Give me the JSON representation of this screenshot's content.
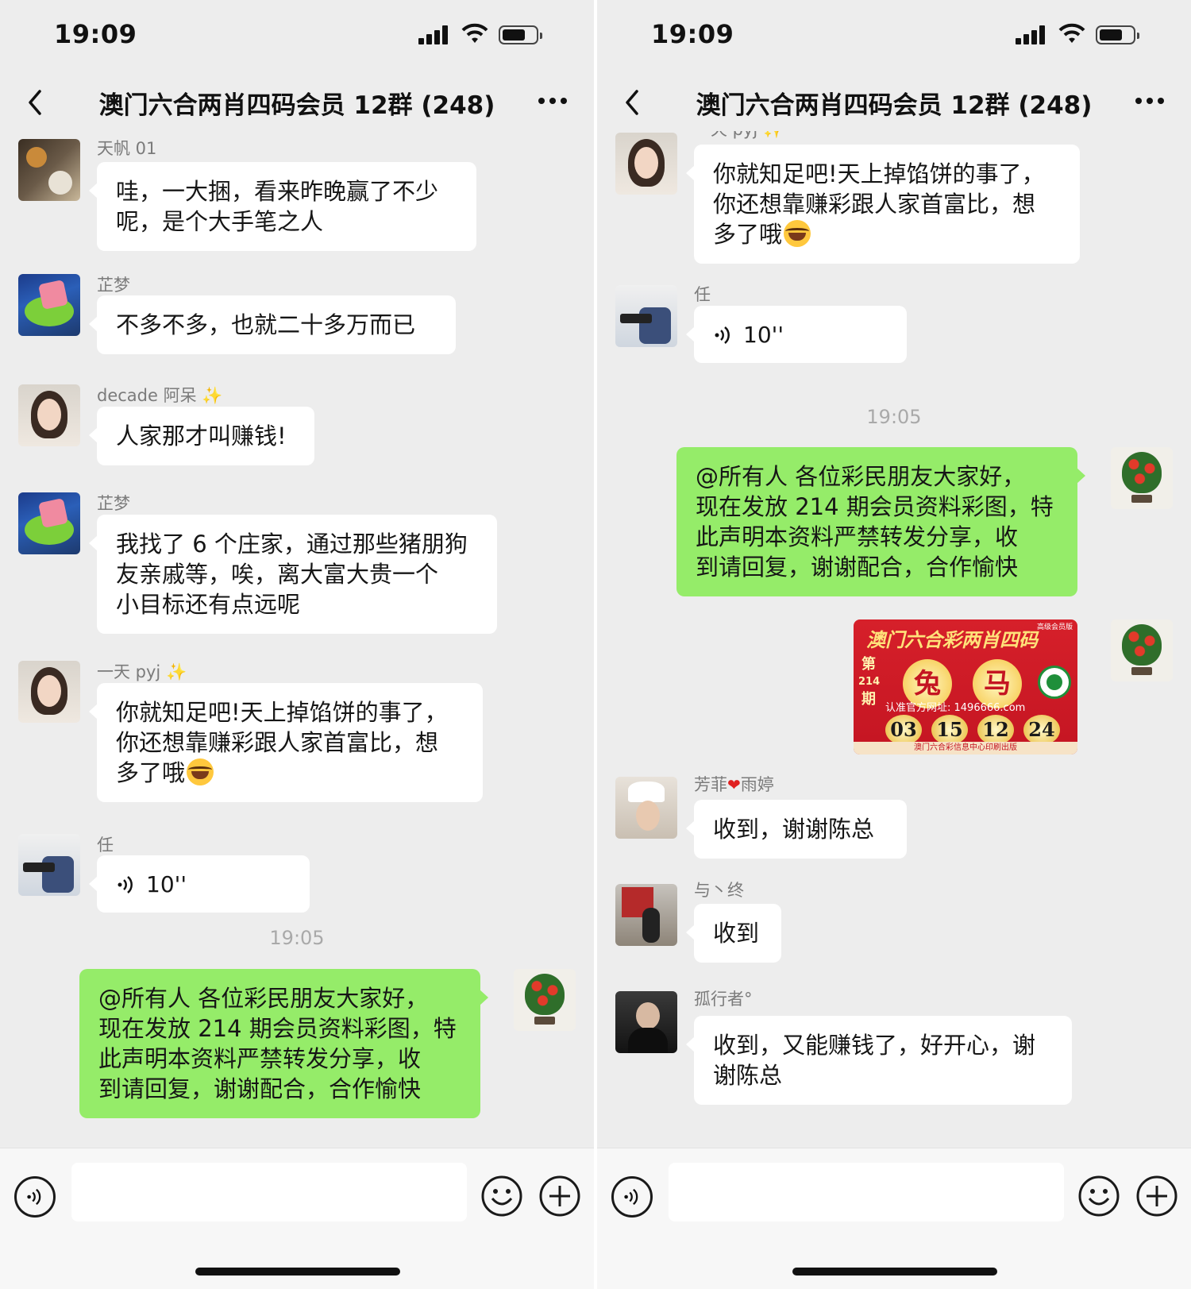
{
  "status": {
    "time": "19:09"
  },
  "header": {
    "title": "澳门六合两肖四码会员 12群 (248)"
  },
  "left": {
    "messages": [
      {
        "sender": "天帆 01",
        "lines": [
          "哇，一大捆，看来昨晚赢了不少",
          "呢，是个大手笔之人"
        ]
      },
      {
        "sender": "芷梦",
        "lines": [
          "不多不多，也就二十多万而已"
        ]
      },
      {
        "sender": "decade 阿呆",
        "lines": [
          "人家那才叫赚钱!"
        ]
      },
      {
        "sender": "芷梦",
        "lines": [
          "我找了 6 个庄家，通过那些猪朋狗",
          "友亲戚等，唉，离大富大贵一个",
          "小目标还有点远呢"
        ]
      },
      {
        "sender": "一天 pyj",
        "lines": [
          "你就知足吧!天上掉馅饼的事了，",
          "你还想靠赚彩跟人家首富比，想",
          "多了哦"
        ]
      },
      {
        "sender": "任",
        "voice": "10''"
      }
    ],
    "timestamp": "19:05",
    "outgoing": {
      "lines": [
        "@所有人  各位彩民朋友大家好，",
        "现在发放 214 期会员资料彩图，特",
        "此声明本资料严禁转发分享，收",
        "到请回复，谢谢配合，合作愉快"
      ]
    }
  },
  "right": {
    "top_sender_partial": "一天 pyj",
    "messages": [
      {
        "lines": [
          "你就知足吧!天上掉馅饼的事了，",
          "你还想靠赚彩跟人家首富比，想",
          "多了哦"
        ]
      },
      {
        "sender": "任",
        "voice": "10''"
      }
    ],
    "timestamp": "19:05",
    "outgoing": {
      "lines": [
        "@所有人  各位彩民朋友大家好，",
        "现在发放 214 期会员资料彩图，特",
        "此声明本资料严禁转发分享，收",
        "到请回复，谢谢配合，合作愉快"
      ]
    },
    "lottery_image": {
      "title": "澳门六合彩两肖四码",
      "tag": "高级会员版",
      "issue": [
        "第",
        "214",
        "期"
      ],
      "zodiac": [
        "兔",
        "马"
      ],
      "site": "认准官方网址: 1496666.com",
      "numbers": [
        "03",
        "15",
        "12",
        "24"
      ],
      "footer": "澳门六合彩信息中心印刷出版"
    },
    "replies": [
      {
        "sender_a": "芳菲",
        "sender_b": "雨婷",
        "lines": [
          "收到，谢谢陈总"
        ]
      },
      {
        "sender": "与丶终",
        "lines": [
          "收到"
        ]
      },
      {
        "sender": "孤行者°",
        "lines": [
          "收到，又能赚钱了，好开心，谢",
          "谢陈总"
        ]
      }
    ]
  },
  "colors": {
    "outgoing_bubble": "#95ec69",
    "background": "#ededed"
  },
  "icons": [
    "back-chevron-icon",
    "more-dots-icon",
    "voice-icon",
    "emoji-icon",
    "plus-icon",
    "signal-icon",
    "wifi-icon",
    "battery-icon"
  ]
}
